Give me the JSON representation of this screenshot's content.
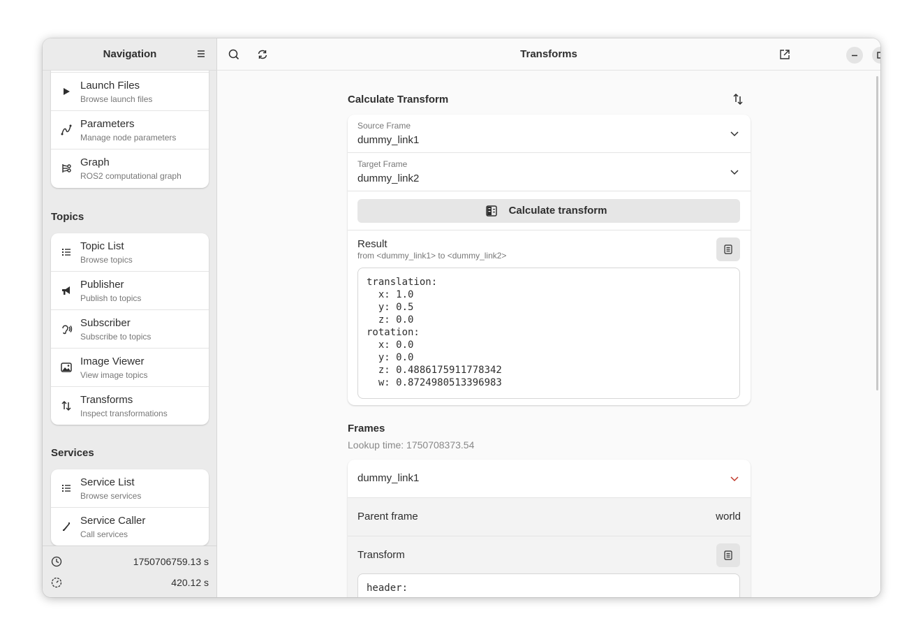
{
  "sidebar": {
    "title": "Navigation",
    "top_items": [
      {
        "label": "Launch Files",
        "sub": "Browse launch files",
        "icon": "play-icon"
      },
      {
        "label": "Parameters",
        "sub": "Manage node parameters",
        "icon": "parameters-icon"
      },
      {
        "label": "Graph",
        "sub": "ROS2 computational graph",
        "icon": "graph-icon"
      }
    ],
    "topics_title": "Topics",
    "topics_items": [
      {
        "label": "Topic List",
        "sub": "Browse topics",
        "icon": "list-icon"
      },
      {
        "label": "Publisher",
        "sub": "Publish to topics",
        "icon": "megaphone-icon"
      },
      {
        "label": "Subscriber",
        "sub": "Subscribe to topics",
        "icon": "ear-icon"
      },
      {
        "label": "Image Viewer",
        "sub": "View image topics",
        "icon": "image-icon"
      },
      {
        "label": "Transforms",
        "sub": "Inspect transformations",
        "icon": "transforms-icon"
      }
    ],
    "services_title": "Services",
    "services_items": [
      {
        "label": "Service List",
        "sub": "Browse services",
        "icon": "list-icon"
      },
      {
        "label": "Service Caller",
        "sub": "Call services",
        "icon": "phone-icon"
      }
    ],
    "footer": {
      "clock_value": "1750706759.13 s",
      "timer_value": "420.12 s"
    }
  },
  "main": {
    "title": "Transforms",
    "calculate": {
      "title": "Calculate Transform",
      "source_label": "Source Frame",
      "source_value": "dummy_link1",
      "target_label": "Target Frame",
      "target_value": "dummy_link2",
      "button_label": "Calculate transform",
      "result_label": "Result",
      "result_sub": "from <dummy_link1> to <dummy_link2>",
      "result_text": "translation:\n  x: 1.0\n  y: 0.5\n  z: 0.0\nrotation:\n  x: 0.0\n  y: 0.0\n  z: 0.4886175911778342\n  w: 0.8724980513396983"
    },
    "frames": {
      "title": "Frames",
      "lookup_time": "Lookup time: 1750708373.54",
      "frame_name": "dummy_link1",
      "parent_label": "Parent frame",
      "parent_value": "world",
      "transform_label": "Transform",
      "transform_text": "header:"
    }
  },
  "colors": {
    "accent_chevron": "#c0392b"
  }
}
